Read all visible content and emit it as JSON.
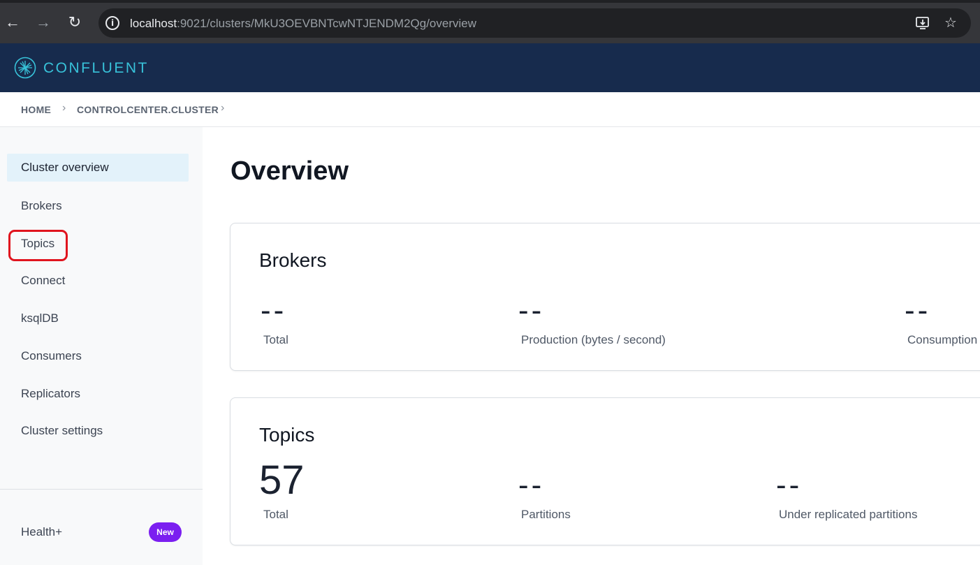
{
  "browser": {
    "url_host": "localhost",
    "url_rest": ":9021/clusters/MkU3OEVBNTcwNTJENDM2Qg/overview",
    "icons": [
      "back-arrow-icon",
      "forward-arrow-icon",
      "reload-icon",
      "info-icon",
      "install-app-icon",
      "star-icon"
    ]
  },
  "header": {
    "brand": "CONFLUENT",
    "brand_color": "#38c2d9",
    "background": "#172b4d"
  },
  "breadcrumb": {
    "items": [
      "HOME",
      "CONTROLCENTER.CLUSTER"
    ]
  },
  "sidebar": {
    "items": [
      {
        "label": "Cluster overview",
        "active": true
      },
      {
        "label": "Brokers"
      },
      {
        "label": "Topics",
        "highlighted": true
      },
      {
        "label": "Connect"
      },
      {
        "label": "ksqlDB"
      },
      {
        "label": "Consumers"
      },
      {
        "label": "Replicators"
      },
      {
        "label": "Cluster settings"
      }
    ],
    "footer_item": {
      "label": "Health+",
      "badge": "New"
    },
    "badge_color": "#7b1ff0",
    "highlight_color": "#e0141e"
  },
  "main": {
    "title": "Overview",
    "brokers_card": {
      "title": "Brokers",
      "metrics": [
        {
          "value": "--",
          "label": "Total"
        },
        {
          "value": "--",
          "label": "Production (bytes / second)"
        },
        {
          "value": "--",
          "label": "Consumption"
        }
      ]
    },
    "topics_card": {
      "title": "Topics",
      "metrics": [
        {
          "value": "57",
          "label": "Total"
        },
        {
          "value": "--",
          "label": "Partitions"
        },
        {
          "value": "--",
          "label": "Under replicated partitions"
        }
      ]
    }
  }
}
